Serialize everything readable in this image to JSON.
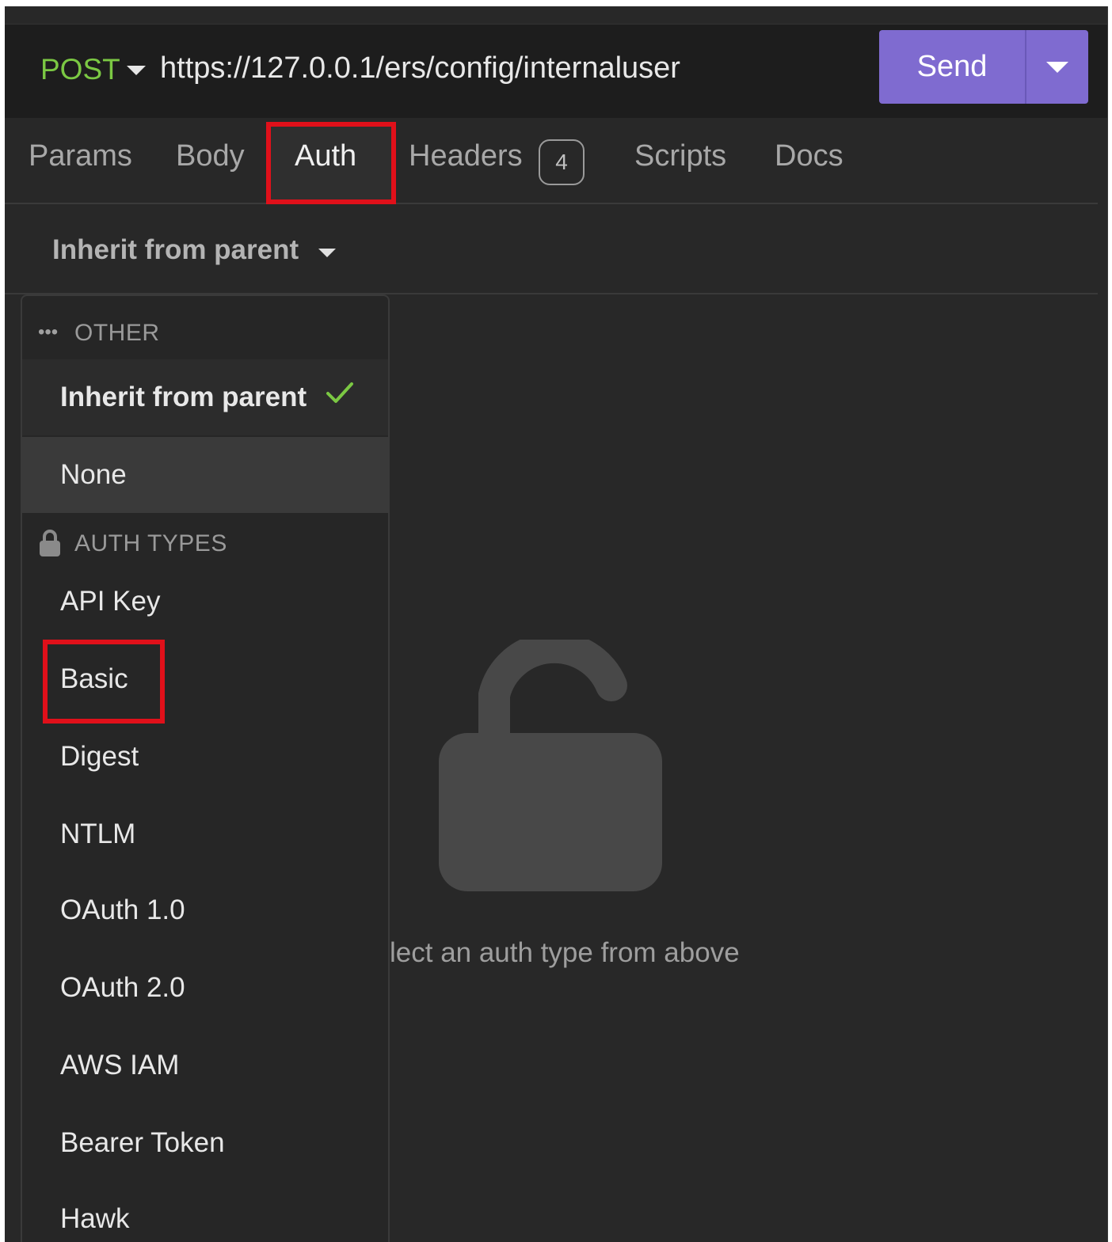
{
  "request": {
    "method": "POST",
    "url": "https://127.0.0.1/ers/config/internaluser",
    "send_label": "Send"
  },
  "tabs": [
    {
      "label": "Params"
    },
    {
      "label": "Body"
    },
    {
      "label": "Auth",
      "active": true
    },
    {
      "label": "Headers",
      "badge": "4"
    },
    {
      "label": "Scripts"
    },
    {
      "label": "Docs"
    }
  ],
  "auth": {
    "selected_type": "Inherit from parent"
  },
  "dropdown": {
    "other_header": "OTHER",
    "other_items": [
      {
        "label": "Inherit from parent",
        "selected": true
      },
      {
        "label": "None"
      }
    ],
    "auth_types_header": "AUTH TYPES",
    "auth_type_items": [
      {
        "label": "API Key"
      },
      {
        "label": "Basic"
      },
      {
        "label": "Digest"
      },
      {
        "label": "NTLM"
      },
      {
        "label": "OAuth 1.0"
      },
      {
        "label": "OAuth 2.0"
      },
      {
        "label": "AWS IAM"
      },
      {
        "label": "Bearer Token"
      },
      {
        "label": "Hawk"
      }
    ]
  },
  "empty_state": {
    "message": "lect an auth type from above"
  },
  "colors": {
    "method": "#7bc843",
    "send_button": "#7f6bd0",
    "highlight": "#e0101a",
    "check": "#7bc843"
  }
}
